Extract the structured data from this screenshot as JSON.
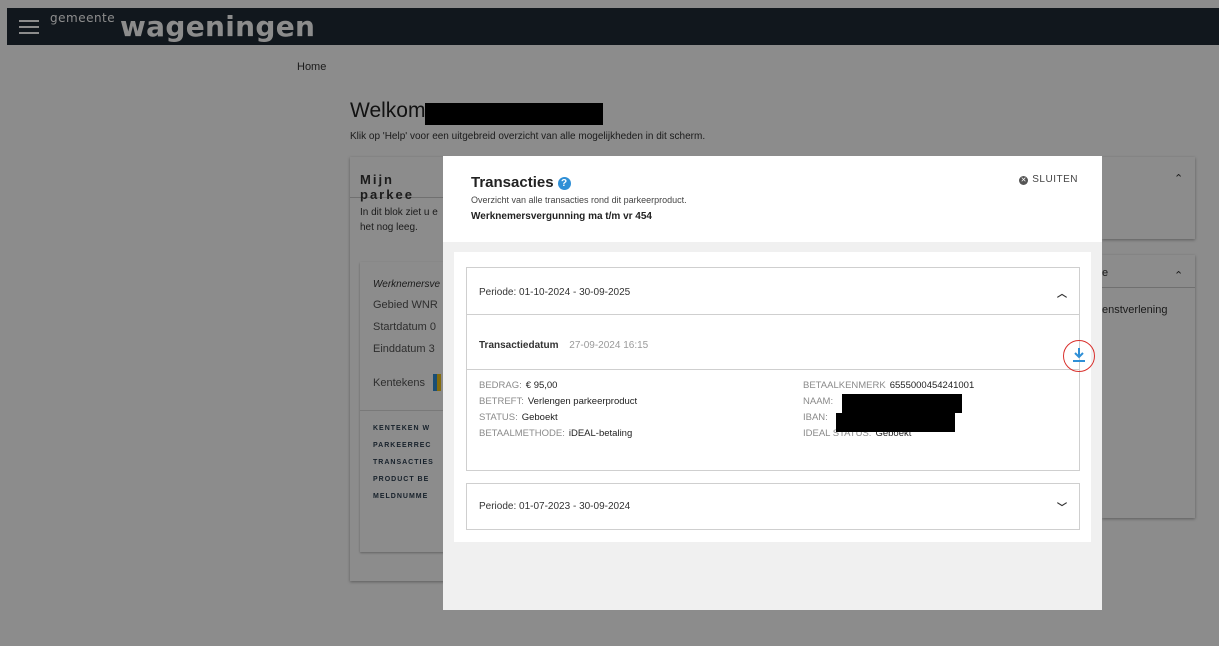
{
  "header": {
    "logo_small": "gemeente",
    "logo_big": "wageningen"
  },
  "breadcrumb": "Home",
  "welcome": {
    "title": "Welkom",
    "intro": "Klik op 'Help' voor een uitgebreid overzicht van alle mogelijkheden in dit scherm."
  },
  "card_left": {
    "title": "Mijn parkee",
    "text_line1": "In dit blok ziet u e",
    "text_line2": "het nog leeg.",
    "product_name": "Werknemersve",
    "lines": [
      "Gebied  WNR",
      "Startdatum  0",
      "Einddatum  3"
    ],
    "kenteken": "Kentekens",
    "actions": [
      "KENTEKEN W",
      "PARKEERREC",
      "TRANSACTIES",
      "PRODUCT BE",
      "MELDNUMME"
    ]
  },
  "card_right": {
    "partial_text": "enstverlening",
    "partial_title": "e"
  },
  "modal": {
    "title": "Transacties",
    "help_icon": "?",
    "subtitle": "Overzicht van alle transacties rond dit parkeerproduct.",
    "product": "Werknemersvergunning ma t/m vr 454",
    "close_label": "SLUITEN",
    "periods": [
      {
        "label": "Periode: 01-10-2024 - 30-09-2025",
        "expanded": true
      },
      {
        "label": "Periode: 01-07-2023 - 30-09-2024",
        "expanded": false
      }
    ],
    "transaction": {
      "date_label": "Transactiedatum",
      "date_value": "27-09-2024 16:15",
      "left": [
        {
          "label": "BEDRAG:",
          "value": "€ 95,00"
        },
        {
          "label": "BETREFT:",
          "value": "Verlengen parkeerproduct"
        },
        {
          "label": "STATUS:",
          "value": "Geboekt"
        },
        {
          "label": "BETAALMETHODE:",
          "value": "iDEAL-betaling"
        }
      ],
      "right": [
        {
          "label": "BETAALKENMERK",
          "value": "6555000454241001"
        },
        {
          "label": "NAAM:",
          "value": ""
        },
        {
          "label": "IBAN:",
          "value": ""
        },
        {
          "label": "IDEAL STATUS:",
          "value": "Geboekt"
        }
      ]
    }
  },
  "colors": {
    "topbar": "#1f2a36",
    "accent": "#2f8fd6",
    "highlight": "#d9302c"
  }
}
